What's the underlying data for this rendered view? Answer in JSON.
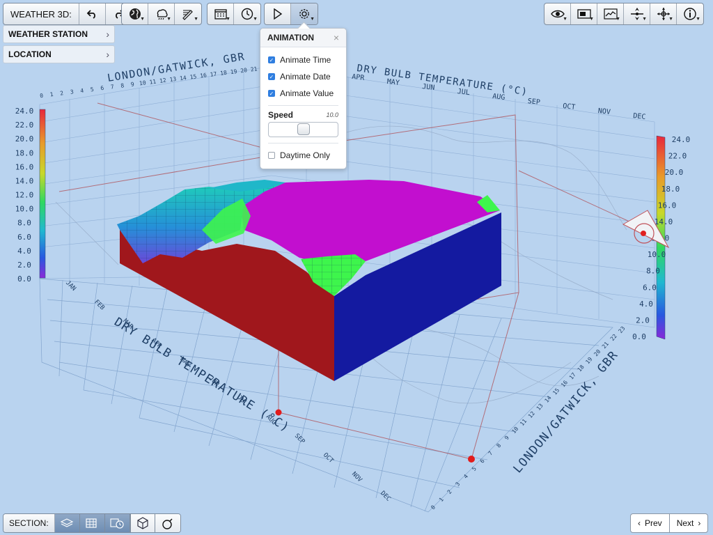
{
  "toolbar": {
    "app_label": "WEATHER 3D:"
  },
  "sidebar": {
    "weather_station": "WEATHER STATION",
    "location": "LOCATION"
  },
  "animation_panel": {
    "title": "ANIMATION",
    "close": "×",
    "options": [
      {
        "label": "Animate Time",
        "checked": true
      },
      {
        "label": "Animate Date",
        "checked": true
      },
      {
        "label": "Animate Value",
        "checked": true
      }
    ],
    "speed_label": "Speed",
    "speed_value": "10.0",
    "speed_fraction": 0.5,
    "daytime_only": {
      "label": "Daytime Only",
      "checked": false
    }
  },
  "chart": {
    "location_title": "LONDON/GATWICK, GBR",
    "metric_title": "DRY BULB TEMPERATURE (°C)",
    "scale_left": [
      "24.0",
      "22.0",
      "20.0",
      "18.0",
      "16.0",
      "14.0",
      "12.0",
      "10.0",
      "8.0",
      "6.0",
      "4.0",
      "2.0",
      "0.0"
    ],
    "scale_right": [
      "24.0",
      "22.0",
      "20.0",
      "18.0",
      "16.0",
      "14.0",
      "12.0",
      "10.0",
      "8.0",
      "6.0",
      "4.0",
      "2.0",
      "0.0"
    ],
    "hours_back": [
      "0",
      "1",
      "2",
      "3",
      "4",
      "5",
      "6",
      "7",
      "8",
      "9",
      "10",
      "11",
      "12",
      "13",
      "14",
      "15",
      "16",
      "17",
      "18",
      "19",
      "20",
      "21"
    ],
    "months_back": [
      "APR",
      "MAY",
      "JUN",
      "JUL",
      "AUG",
      "SEP",
      "OCT",
      "NOV",
      "DEC"
    ],
    "months_front": [
      "JAN",
      "FEB",
      "MAR",
      "APR",
      "MAY",
      "JUN",
      "JUL",
      "AUG",
      "SEP",
      "OCT",
      "NOV",
      "DEC"
    ],
    "hours_right": [
      "0",
      "1",
      "2",
      "3",
      "4",
      "5",
      "6",
      "7",
      "8",
      "9",
      "10",
      "11",
      "12",
      "13",
      "14",
      "15",
      "16",
      "17",
      "18",
      "19",
      "20",
      "21",
      "22",
      "23"
    ],
    "colors": {
      "surface_top": "#c20fcf",
      "side_left": "#a0171c",
      "side_right": "#141aa0",
      "accent_green": "#3ef54c",
      "accent_cyan": "#1fb7c9"
    }
  },
  "bottom": {
    "section_label": "SECTION:",
    "prev": "Prev",
    "next": "Next"
  }
}
